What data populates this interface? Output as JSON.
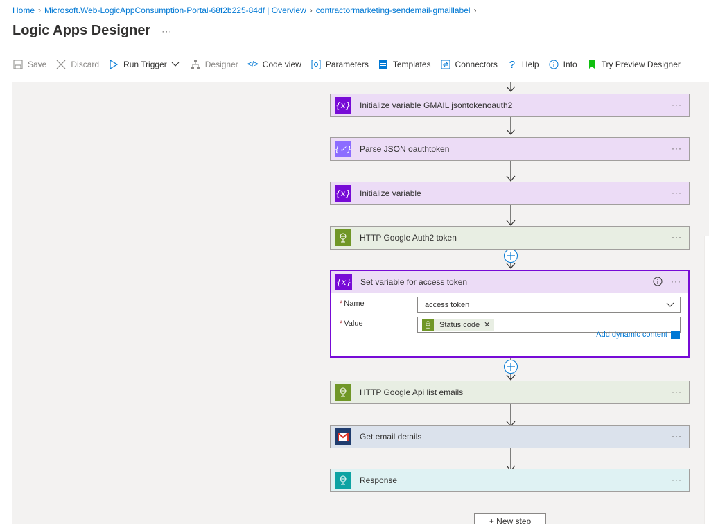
{
  "breadcrumb": [
    "Home",
    "Microsoft.Web-LogicAppConsumption-Portal-68f2b225-84df | Overview",
    "contractormarketing-sendemail-gmaillabel",
    ""
  ],
  "page": {
    "title": "Logic Apps Designer",
    "more": "···"
  },
  "toolbar": {
    "save": "Save",
    "discard": "Discard",
    "run_trigger": "Run Trigger",
    "designer": "Designer",
    "code_view": "Code view",
    "parameters": "Parameters",
    "templates": "Templates",
    "connectors": "Connectors",
    "help": "Help",
    "info": "Info",
    "try_preview": "Try Preview Designer"
  },
  "steps": {
    "s1": "Initialize variable GMAIL jsontokenoauth2",
    "s2": "Parse JSON oauthtoken",
    "s3": "Initialize variable",
    "s4": "HTTP Google Auth2 token",
    "s5": "Set variable for access token",
    "s6": "HTTP Google Api list emails",
    "s7": "Get email details",
    "s8": "Response"
  },
  "icons": {
    "variable": "{x}",
    "parse": "{✓}",
    "http": "http-globe-icon",
    "gmail": "gmail-icon",
    "response": "response-globe-icon"
  },
  "form": {
    "name_label": "Name",
    "name_value": "access token",
    "value_label": "Value",
    "value_token": "Status code",
    "add_dynamic": "Add dynamic content",
    "required": "*"
  },
  "more": "···",
  "new_step": "+ New step",
  "colors": {
    "variable": "#770bd6",
    "http": "#709727",
    "gmail": "#1f3c6e",
    "response": "#0da3a3",
    "link": "#0078d4"
  }
}
